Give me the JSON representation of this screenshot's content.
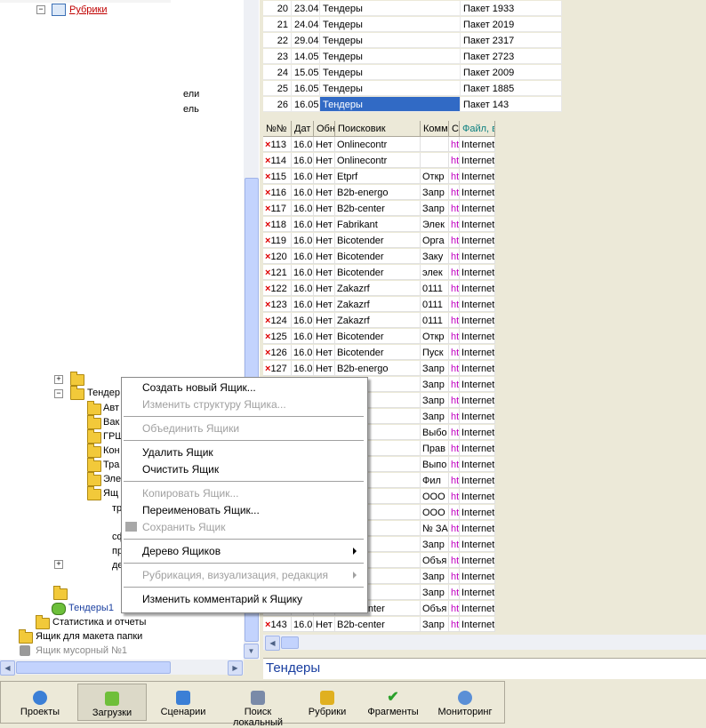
{
  "tree": {
    "rubriki": "Рубрики",
    "partial_1": "ели",
    "partial_2": "ель",
    "tendery_folder": "Тендер",
    "children": [
      "Авт",
      "Вак",
      "ГРШ",
      "Кон",
      "Тра",
      "Эле",
      "Ящ"
    ],
    "partial_3": "тр",
    "partial_4": "сф",
    "partial_5": "пр",
    "partial_6": "де",
    "selected_item": "Тендеры1",
    "stats": "Статистика и отчеты",
    "box_template": "Ящик для  макета папки",
    "trash": "Ящик мусорный №1"
  },
  "top_table": {
    "rows": [
      {
        "n": "20",
        "date": "23.04",
        "name": "Тендеры",
        "pkg": "Пакет 1933"
      },
      {
        "n": "21",
        "date": "24.04",
        "name": "Тендеры",
        "pkg": "Пакет 2019"
      },
      {
        "n": "22",
        "date": "29.04",
        "name": "Тендеры",
        "pkg": "Пакет 2317"
      },
      {
        "n": "23",
        "date": "14.05",
        "name": "Тендеры",
        "pkg": "Пакет 2723"
      },
      {
        "n": "24",
        "date": "15.05",
        "name": "Тендеры",
        "pkg": "Пакет 2009"
      },
      {
        "n": "25",
        "date": "16.05",
        "name": "Тендеры",
        "pkg": "Пакет 1885"
      },
      {
        "n": "26",
        "date": "16.05",
        "name": "Тендеры",
        "pkg": "Пакет 143"
      }
    ]
  },
  "grid": {
    "headers": [
      "№№",
      "Дат",
      "Обн",
      "Поисковик",
      "Комм",
      "С",
      "Файл, в"
    ],
    "rows": [
      {
        "n": "113",
        "d": "16.0",
        "o": "Нет",
        "s": "Onlinecontr",
        "c": "",
        "h": "ht",
        "f": "Internet"
      },
      {
        "n": "114",
        "d": "16.0",
        "o": "Нет",
        "s": "Onlinecontr",
        "c": "",
        "h": "ht",
        "f": "Internet"
      },
      {
        "n": "115",
        "d": "16.0",
        "o": "Нет",
        "s": "Etprf",
        "c": "Откр",
        "h": "ht",
        "f": "Internet"
      },
      {
        "n": "116",
        "d": "16.0",
        "o": "Нет",
        "s": "B2b-energo",
        "c": "Запр",
        "h": "ht",
        "f": "Internet"
      },
      {
        "n": "117",
        "d": "16.0",
        "o": "Нет",
        "s": "B2b-center",
        "c": "Запр",
        "h": "ht",
        "f": "Internet"
      },
      {
        "n": "118",
        "d": "16.0",
        "o": "Нет",
        "s": "Fabrikant",
        "c": "Элек",
        "h": "ht",
        "f": "Internet"
      },
      {
        "n": "119",
        "d": "16.0",
        "o": "Нет",
        "s": "Bicotender",
        "c": "Орга",
        "h": "ht",
        "f": "Internet"
      },
      {
        "n": "120",
        "d": "16.0",
        "o": "Нет",
        "s": "Bicotender",
        "c": "Заку",
        "h": "ht",
        "f": "Internet"
      },
      {
        "n": "121",
        "d": "16.0",
        "o": "Нет",
        "s": "Bicotender",
        "c": "элек",
        "h": "ht",
        "f": "Internet"
      },
      {
        "n": "122",
        "d": "16.0",
        "o": "Нет",
        "s": "Zakazrf",
        "c": "0111",
        "h": "ht",
        "f": "Internet"
      },
      {
        "n": "123",
        "d": "16.0",
        "o": "Нет",
        "s": "Zakazrf",
        "c": "0111",
        "h": "ht",
        "f": "Internet"
      },
      {
        "n": "124",
        "d": "16.0",
        "o": "Нет",
        "s": "Zakazrf",
        "c": "0111",
        "h": "ht",
        "f": "Internet"
      },
      {
        "n": "125",
        "d": "16.0",
        "o": "Нет",
        "s": "Bicotender",
        "c": "Откр",
        "h": "ht",
        "f": "Internet"
      },
      {
        "n": "126",
        "d": "16.0",
        "o": "Нет",
        "s": "Bicotender",
        "c": "Пуск",
        "h": "ht",
        "f": "Internet"
      },
      {
        "n": "127",
        "d": "16.0",
        "o": "Нет",
        "s": "B2b-energo",
        "c": "Запр",
        "h": "ht",
        "f": "Internet"
      },
      {
        "n": "",
        "d": "",
        "o": "",
        "s": "ergo",
        "c": "Запр",
        "h": "ht",
        "f": "Internet"
      },
      {
        "n": "",
        "d": "",
        "o": "",
        "s": "enter",
        "c": "Запр",
        "h": "ht",
        "f": "Internet"
      },
      {
        "n": "",
        "d": "",
        "o": "",
        "s": "enter",
        "c": "Запр",
        "h": "ht",
        "f": "Internet"
      },
      {
        "n": "",
        "d": "",
        "o": "",
        "s": "2014",
        "c": "Выбо",
        "h": "ht",
        "f": "Internet"
      },
      {
        "n": "",
        "d": "",
        "o": "",
        "s": "ender",
        "c": "Прав",
        "h": "ht",
        "f": "Internet"
      },
      {
        "n": "",
        "d": "",
        "o": "",
        "s": "ender",
        "c": "Выпо",
        "h": "ht",
        "f": "Internet"
      },
      {
        "n": "",
        "d": "",
        "o": "",
        "s": "ender",
        "c": "Фил",
        "h": "ht",
        "f": "Internet"
      },
      {
        "n": "",
        "d": "",
        "o": "",
        "s": "ender",
        "c": "ООО",
        "h": "ht",
        "f": "Internet"
      },
      {
        "n": "",
        "d": "",
        "o": "",
        "s": "ender",
        "c": "ООО",
        "h": "ht",
        "f": "Internet"
      },
      {
        "n": "",
        "d": "",
        "o": "",
        "s": "ender",
        "c": "№ ЗА",
        "h": "ht",
        "f": "Internet"
      },
      {
        "n": "",
        "d": "",
        "o": "",
        "s": "ergo",
        "c": "Запр",
        "h": "ht",
        "f": "Internet"
      },
      {
        "n": "",
        "d": "",
        "o": "",
        "s": "ergo",
        "c": "Объя",
        "h": "ht",
        "f": "Internet"
      },
      {
        "n": "",
        "d": "",
        "o": "",
        "s": "ergo",
        "c": "Запр",
        "h": "ht",
        "f": "Internet"
      },
      {
        "n": "",
        "d": "",
        "o": "",
        "s": "enter",
        "c": "Запр",
        "h": "ht",
        "f": "Internet"
      },
      {
        "n": "142",
        "d": "16.0",
        "o": "Нет",
        "s": "B2b-center",
        "c": "Объя",
        "h": "ht",
        "f": "Internet"
      },
      {
        "n": "143",
        "d": "16.0",
        "o": "Нет",
        "s": "B2b-center",
        "c": "Запр",
        "h": "ht",
        "f": "Internet"
      }
    ]
  },
  "status_label": "Тендеры",
  "toolbar": {
    "buttons": [
      "Проекты",
      "Загрузки",
      "Сценарии",
      "Поиск локальный",
      "Рубрики",
      "Фрагменты",
      "Мониторинг"
    ]
  },
  "menu": {
    "create": "Создать новый Ящик...",
    "edit_structure": "Изменить структуру Ящика...",
    "merge": "Объединить Ящики",
    "delete": "Удалить Ящик",
    "clear": "Очистить Ящик",
    "copy": "Копировать Ящик...",
    "rename": "Переименовать Ящик...",
    "save": "Сохранить Ящик",
    "tree": "Дерево Ящиков",
    "rubric": "Рубрикация, визуализация, редакция",
    "comment": "Изменить комментарий к Ящику"
  }
}
